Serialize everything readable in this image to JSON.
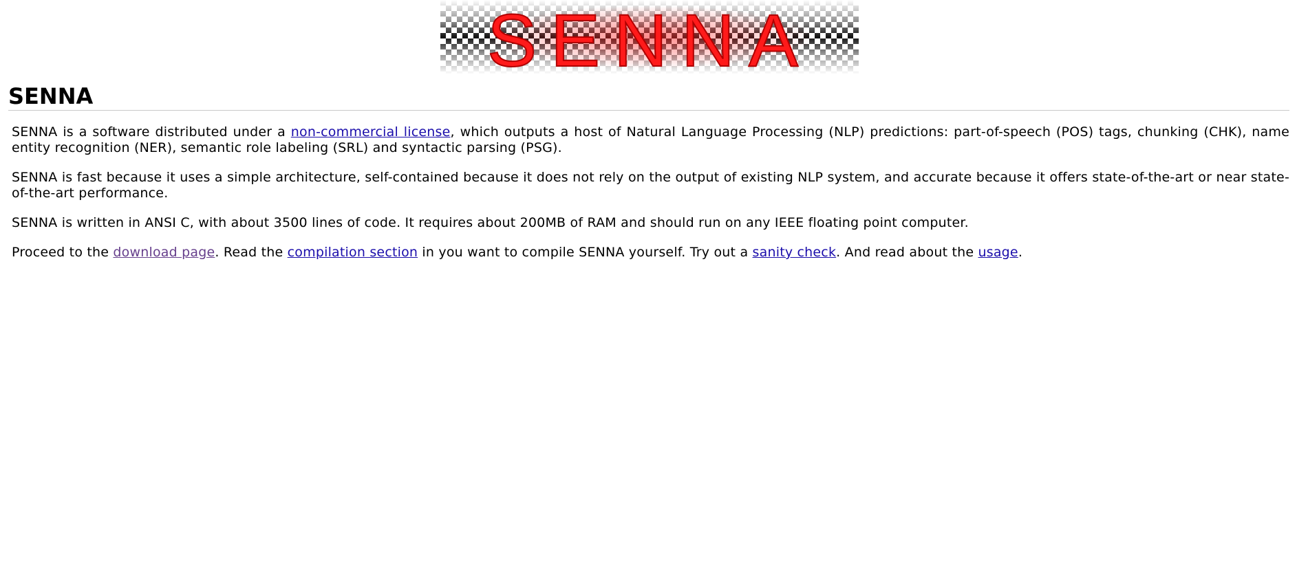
{
  "banner": {
    "logo_text": "SENNA"
  },
  "heading": {
    "title": "SENNA"
  },
  "paragraphs": {
    "p1": {
      "before": "SENNA is a software distributed under a ",
      "link": "non-commercial license",
      "after": ", which outputs a host of Natural Language Processing (NLP) predictions: part-of-speech (POS) tags, chunking (CHK), name entity recognition (NER), semantic role labeling (SRL) and syntactic parsing (PSG)."
    },
    "p2": {
      "text": "SENNA is fast because it uses a simple architecture, self-contained because it does not rely on the output of existing NLP system, and accurate because it offers state-of-the-art or near state-of-the-art performance."
    },
    "p3": {
      "text": "SENNA is written in ANSI C, with about 3500 lines of code. It requires about 200MB of RAM and should run on any IEEE floating point computer."
    },
    "p4": {
      "t1": "Proceed to the ",
      "download_link": "download page",
      "t2": ". Read the ",
      "compilation_link": "compilation section",
      "t3": " in you want to compile SENNA yourself. Try out a ",
      "sanity_link": "sanity check",
      "t4": ". And read about the ",
      "usage_link": "usage",
      "t5": "."
    }
  },
  "colors": {
    "link": "#1a0dab",
    "visited_link": "#663f8c",
    "logo_red": "#ff1a1a",
    "rule": "#c8c8c8"
  }
}
